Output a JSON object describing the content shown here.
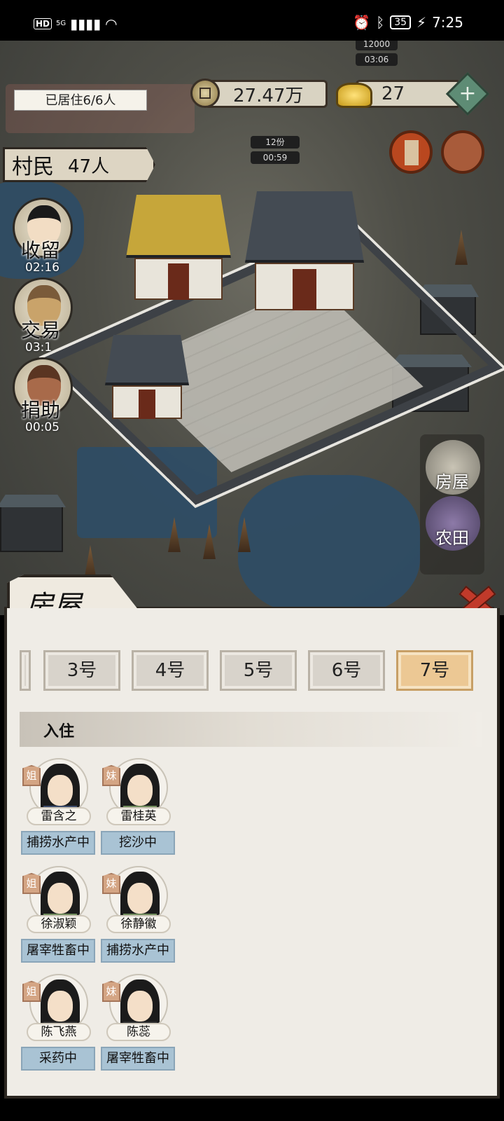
{
  "status_bar": {
    "hd": "HD",
    "signal": "5G",
    "battery": "35",
    "time": "7:25"
  },
  "hud": {
    "occupancy": "已居住6/6人",
    "copper": "27.47万",
    "ingots": "27",
    "plus": "+",
    "villagers_label": "村民",
    "villagers_value": "47人",
    "top_timer_amount": "12000",
    "top_timer": "03:06",
    "center_timer_amount": "12份",
    "center_timer": "00:59"
  },
  "side_actions": [
    {
      "label": "收留",
      "time": "02:16"
    },
    {
      "label": "交易",
      "time": "03:1"
    },
    {
      "label": "捐助",
      "time": "00:05"
    }
  ],
  "build_menu": {
    "items": [
      {
        "label": "房屋"
      },
      {
        "label": "农田"
      }
    ]
  },
  "panel": {
    "title": "房屋",
    "tabs": [
      "3号",
      "4号",
      "5号",
      "6号",
      "7号"
    ],
    "active_tab": "7号",
    "section_title": "入住",
    "residents": [
      {
        "role": "姐",
        "name": "雷含之",
        "job": "捕捞水产中"
      },
      {
        "role": "妹",
        "name": "雷桂英",
        "job": "挖沙中"
      },
      {
        "role": "姐",
        "name": "徐淑颖",
        "job": "屠宰牲畜中"
      },
      {
        "role": "妹",
        "name": "徐静徽",
        "job": "捕捞水产中"
      },
      {
        "role": "姐",
        "name": "陈飞燕",
        "job": "采药中"
      },
      {
        "role": "妹",
        "name": "陈蕊",
        "job": "屠宰牲畜中"
      }
    ]
  }
}
